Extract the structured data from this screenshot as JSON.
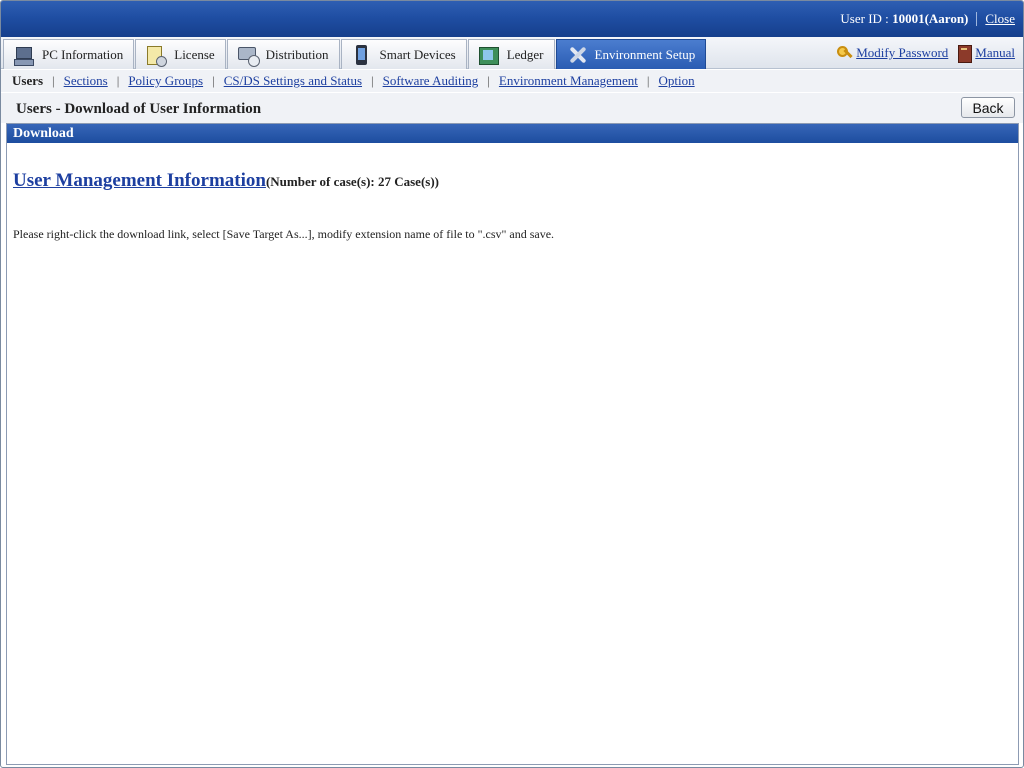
{
  "header": {
    "user_id_label": "User ID : ",
    "user_id_value": "10001(Aaron)",
    "close_label": "Close"
  },
  "tabs": [
    {
      "label": "PC Information",
      "icon": "pc-icon"
    },
    {
      "label": "License",
      "icon": "license-icon"
    },
    {
      "label": "Distribution",
      "icon": "distribution-icon"
    },
    {
      "label": "Smart Devices",
      "icon": "smart-device-icon"
    },
    {
      "label": "Ledger",
      "icon": "ledger-icon"
    },
    {
      "label": "Environment Setup",
      "icon": "tools-icon",
      "active": true
    }
  ],
  "toplinks": {
    "modify_password": "Modify Password",
    "manual": "Manual"
  },
  "subnav": {
    "current": "Users",
    "items": [
      "Sections",
      "Policy Groups",
      "CS/DS Settings and Status",
      "Software Auditing",
      "Environment Management",
      "Option"
    ]
  },
  "page": {
    "title": "Users - Download of User Information",
    "back_label": "Back"
  },
  "panel": {
    "header": "Download",
    "link_text": "User Management Information",
    "count_text": "(Number of case(s): 27 Case(s))",
    "instruction": "Please right-click the download link, select [Save Target As...], modify extension name of file to \".csv\" and save."
  },
  "colors": {
    "banner": "#1f4ea3",
    "active_tab": "#2a5cb3",
    "link": "#1d3fa0"
  }
}
